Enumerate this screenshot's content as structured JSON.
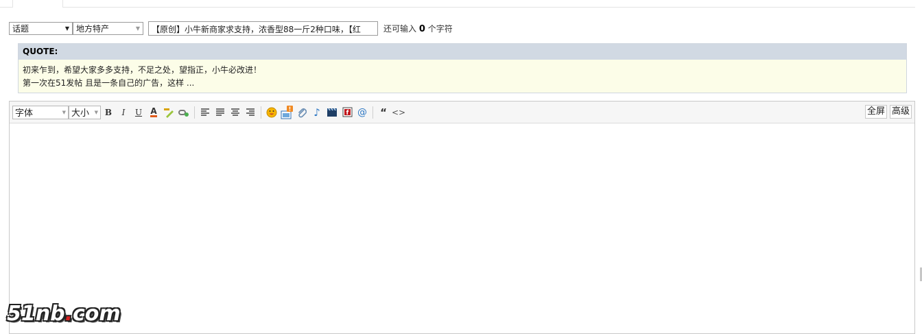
{
  "subject_row": {
    "type_select": "话题",
    "region_select": "地方特产",
    "subject_value": "【原创】小牛新商家求支持，浓香型88一斤2种口味，【红",
    "remain_prefix": "还可输入",
    "remain_count": "0",
    "remain_suffix": "个字符"
  },
  "quote": {
    "header": "QUOTE:",
    "line1": "初来乍到，希望大家多多支持，不足之处，望指正，小牛必改进！",
    "line2": "第一次在51发帖 且是一条自己的广告，这样 ..."
  },
  "toolbar": {
    "font_select": "字体",
    "size_select": "大小",
    "bold": "B",
    "italic": "I",
    "underline": "U",
    "fontcolor": "A",
    "quote_btn": "“",
    "code_btn": "<>",
    "fullscreen": "全屏",
    "advanced": "高级"
  },
  "watermark": {
    "part1": "51nb",
    "dot": ".",
    "part2": "com"
  },
  "colors": {
    "quote_header_bg": "#d1d9e3",
    "quote_body_bg": "#fcfde8"
  }
}
